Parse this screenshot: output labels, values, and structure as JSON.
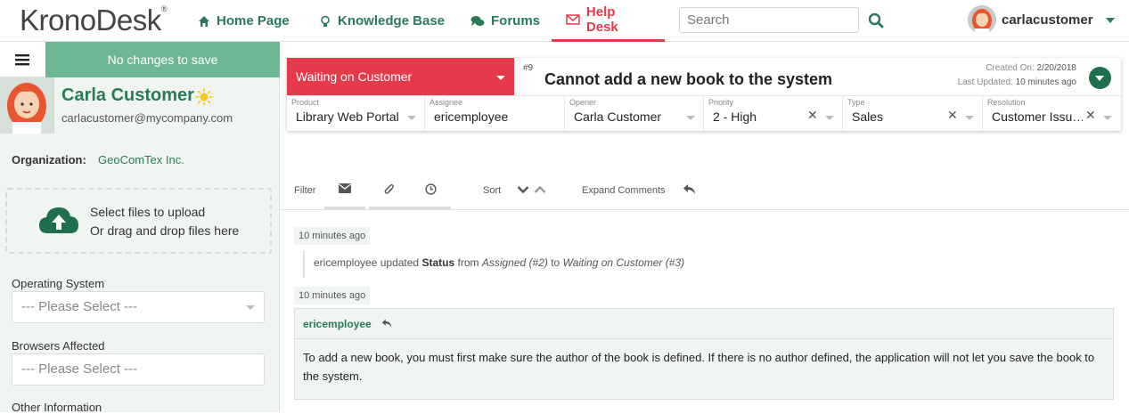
{
  "brand": {
    "logo_text": "KronoDesk",
    "logo_mark": "®"
  },
  "nav": {
    "home": "Home Page",
    "kb": "Knowledge Base",
    "forums": "Forums",
    "helpdesk": "Help Desk",
    "search_placeholder": "Search",
    "user": "carlacustomer"
  },
  "sidebar": {
    "save_status": "No changes to save",
    "customer": {
      "name": "Carla Customer",
      "email": "carlacustomer@mycompany.com"
    },
    "organization_label": "Organization:",
    "organization_value": "GeoComTex Inc.",
    "upload_line1": "Select files to upload",
    "upload_line2": "Or drag and drop files here",
    "fields": [
      {
        "label": "Operating System",
        "value": "--- Please Select ---"
      },
      {
        "label": "Browsers Affected",
        "value": "--- Please Select ---"
      },
      {
        "label": "Other Information",
        "value": ""
      }
    ]
  },
  "ticket": {
    "status": "Waiting on Customer",
    "number": "#9",
    "title": "Cannot add a new book to the system",
    "created_label": "Created On:",
    "created_value": "2/20/2018",
    "updated_label": "Last Updated:",
    "updated_value": "10 minutes ago",
    "fields": [
      {
        "label": "Product",
        "value": "Library Web Portal"
      },
      {
        "label": "Assignee",
        "value": "ericemployee"
      },
      {
        "label": "Opener",
        "value": "Carla Customer"
      },
      {
        "label": "Priority",
        "value": "2 - High"
      },
      {
        "label": "Type",
        "value": "Sales"
      },
      {
        "label": "Resolution",
        "value": "Customer Issu…"
      }
    ]
  },
  "toolbar": {
    "filter": "Filter",
    "sort": "Sort",
    "expand_comments": "Expand Comments"
  },
  "timeline": {
    "event_time": "10 minutes ago",
    "event": {
      "user": "ericemployee",
      "verb": "updated",
      "field": "Status",
      "from_word": "from",
      "old": "Assigned (#2)",
      "to_word": "to",
      "new": "Waiting on Customer (#3)"
    },
    "comment_time": "10 minutes ago",
    "comment": {
      "author": "ericemployee",
      "body": "To add a new book, you must first make sure the author of the book is defined. If there is no author defined, the application will not let you save the book to the system."
    }
  },
  "colors": {
    "accent": "#2a7a59",
    "danger": "#e53a4a",
    "save_bar": "#6db893",
    "sidebar_bg": "#f1f5f1"
  }
}
